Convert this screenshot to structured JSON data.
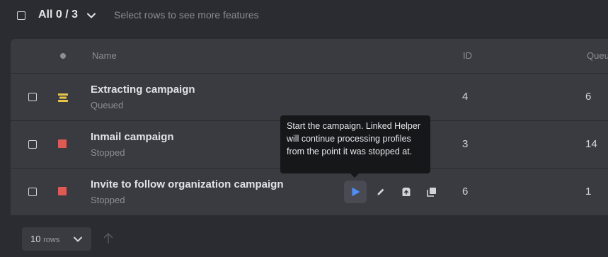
{
  "header": {
    "all_label": "All 0 / 3",
    "hint": "Select rows to see more features"
  },
  "table": {
    "columns": {
      "name": "Name",
      "id": "ID",
      "queue": "Queu"
    },
    "rows": [
      {
        "name": "Extracting campaign",
        "status": "Queued",
        "status_icon": "queued-icon",
        "status_color": "#e8c44a",
        "id": "4",
        "queue": "6"
      },
      {
        "name": "Inmail campaign",
        "status": "Stopped",
        "status_icon": "stopped-icon",
        "status_color": "#e05a55",
        "id": "3",
        "queue": "14"
      },
      {
        "name": "Invite to follow organization campaign",
        "status": "Stopped",
        "status_icon": "stopped-icon",
        "status_color": "#e05a55",
        "id": "6",
        "queue": "1"
      }
    ]
  },
  "row_actions": {
    "icons": [
      "play-icon",
      "edit-icon",
      "archive-icon",
      "duplicate-icon"
    ],
    "accent": "#4f8ef7"
  },
  "tooltip": {
    "text": "Start the campaign. Linked Helper will continue processing profiles from the point it was stopped at."
  },
  "footer": {
    "rows_count": "10",
    "rows_word": "rows"
  }
}
